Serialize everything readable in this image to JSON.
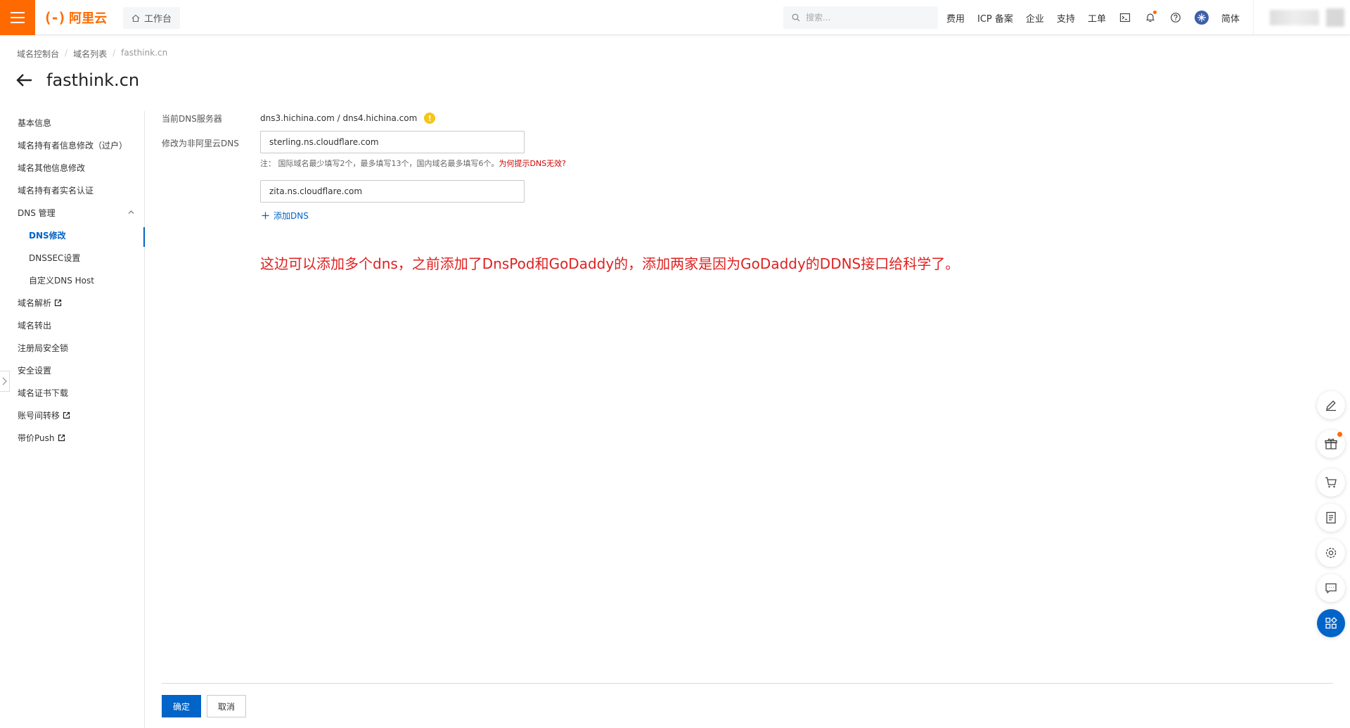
{
  "topbar": {
    "logo_mark": "(-)",
    "logo_text": "阿里云",
    "workbench_label": "工作台",
    "search_placeholder": "搜索...",
    "nav_items": [
      "费用",
      "ICP 备案",
      "企业",
      "支持",
      "工单"
    ],
    "lang_label": "简体"
  },
  "breadcrumb": {
    "items": [
      "域名控制台",
      "域名列表"
    ],
    "current": "fasthink.cn"
  },
  "page_title": "fasthink.cn",
  "sidebar": {
    "items": [
      {
        "label": "基本信息"
      },
      {
        "label": "域名持有者信息修改（过户）"
      },
      {
        "label": "域名其他信息修改"
      },
      {
        "label": "域名持有者实名认证"
      },
      {
        "label": "DNS 管理"
      },
      {
        "label": "DNS修改"
      },
      {
        "label": "DNSSEC设置"
      },
      {
        "label": "自定义DNS Host"
      },
      {
        "label": "域名解析"
      },
      {
        "label": "域名转出"
      },
      {
        "label": "注册局安全锁"
      },
      {
        "label": "安全设置"
      },
      {
        "label": "域名证书下载"
      },
      {
        "label": "账号间转移"
      },
      {
        "label": "带价Push"
      }
    ]
  },
  "form": {
    "current_dns_label": "当前DNS服务器",
    "current_dns_value": "dns3.hichina.com / dns4.hichina.com",
    "change_dns_label": "修改为非阿里云DNS",
    "dns_inputs": [
      "sterling.ns.cloudflare.com",
      "zita.ns.cloudflare.com"
    ],
    "note_text": "注：  国际域名最少填写2个，最多填写13个，国内域名最多填写6个。",
    "note_link": "为何提示DNS无效?",
    "add_dns_label": "添加DNS"
  },
  "annotation": "这边可以添加多个dns，之前添加了DnsPod和GoDaddy的，添加两家是因为GoDaddy的DDNS接口给科学了。",
  "footer": {
    "ok_label": "确定",
    "cancel_label": "取消"
  },
  "colors": {
    "brand": "#ff6a00",
    "primary": "#0064c8",
    "annotation": "#e02020",
    "link_red": "#c00000"
  },
  "icons": [
    "menu-icon",
    "home-icon",
    "search-icon",
    "terminal-icon",
    "bell-icon",
    "help-icon",
    "globe-icon",
    "back-arrow-icon",
    "chevron-up-icon",
    "external-link-icon",
    "warning-icon",
    "plus-icon",
    "edit-icon",
    "gift-icon",
    "cart-icon",
    "document-icon",
    "settings-icon",
    "chat-icon",
    "apps-icon"
  ]
}
